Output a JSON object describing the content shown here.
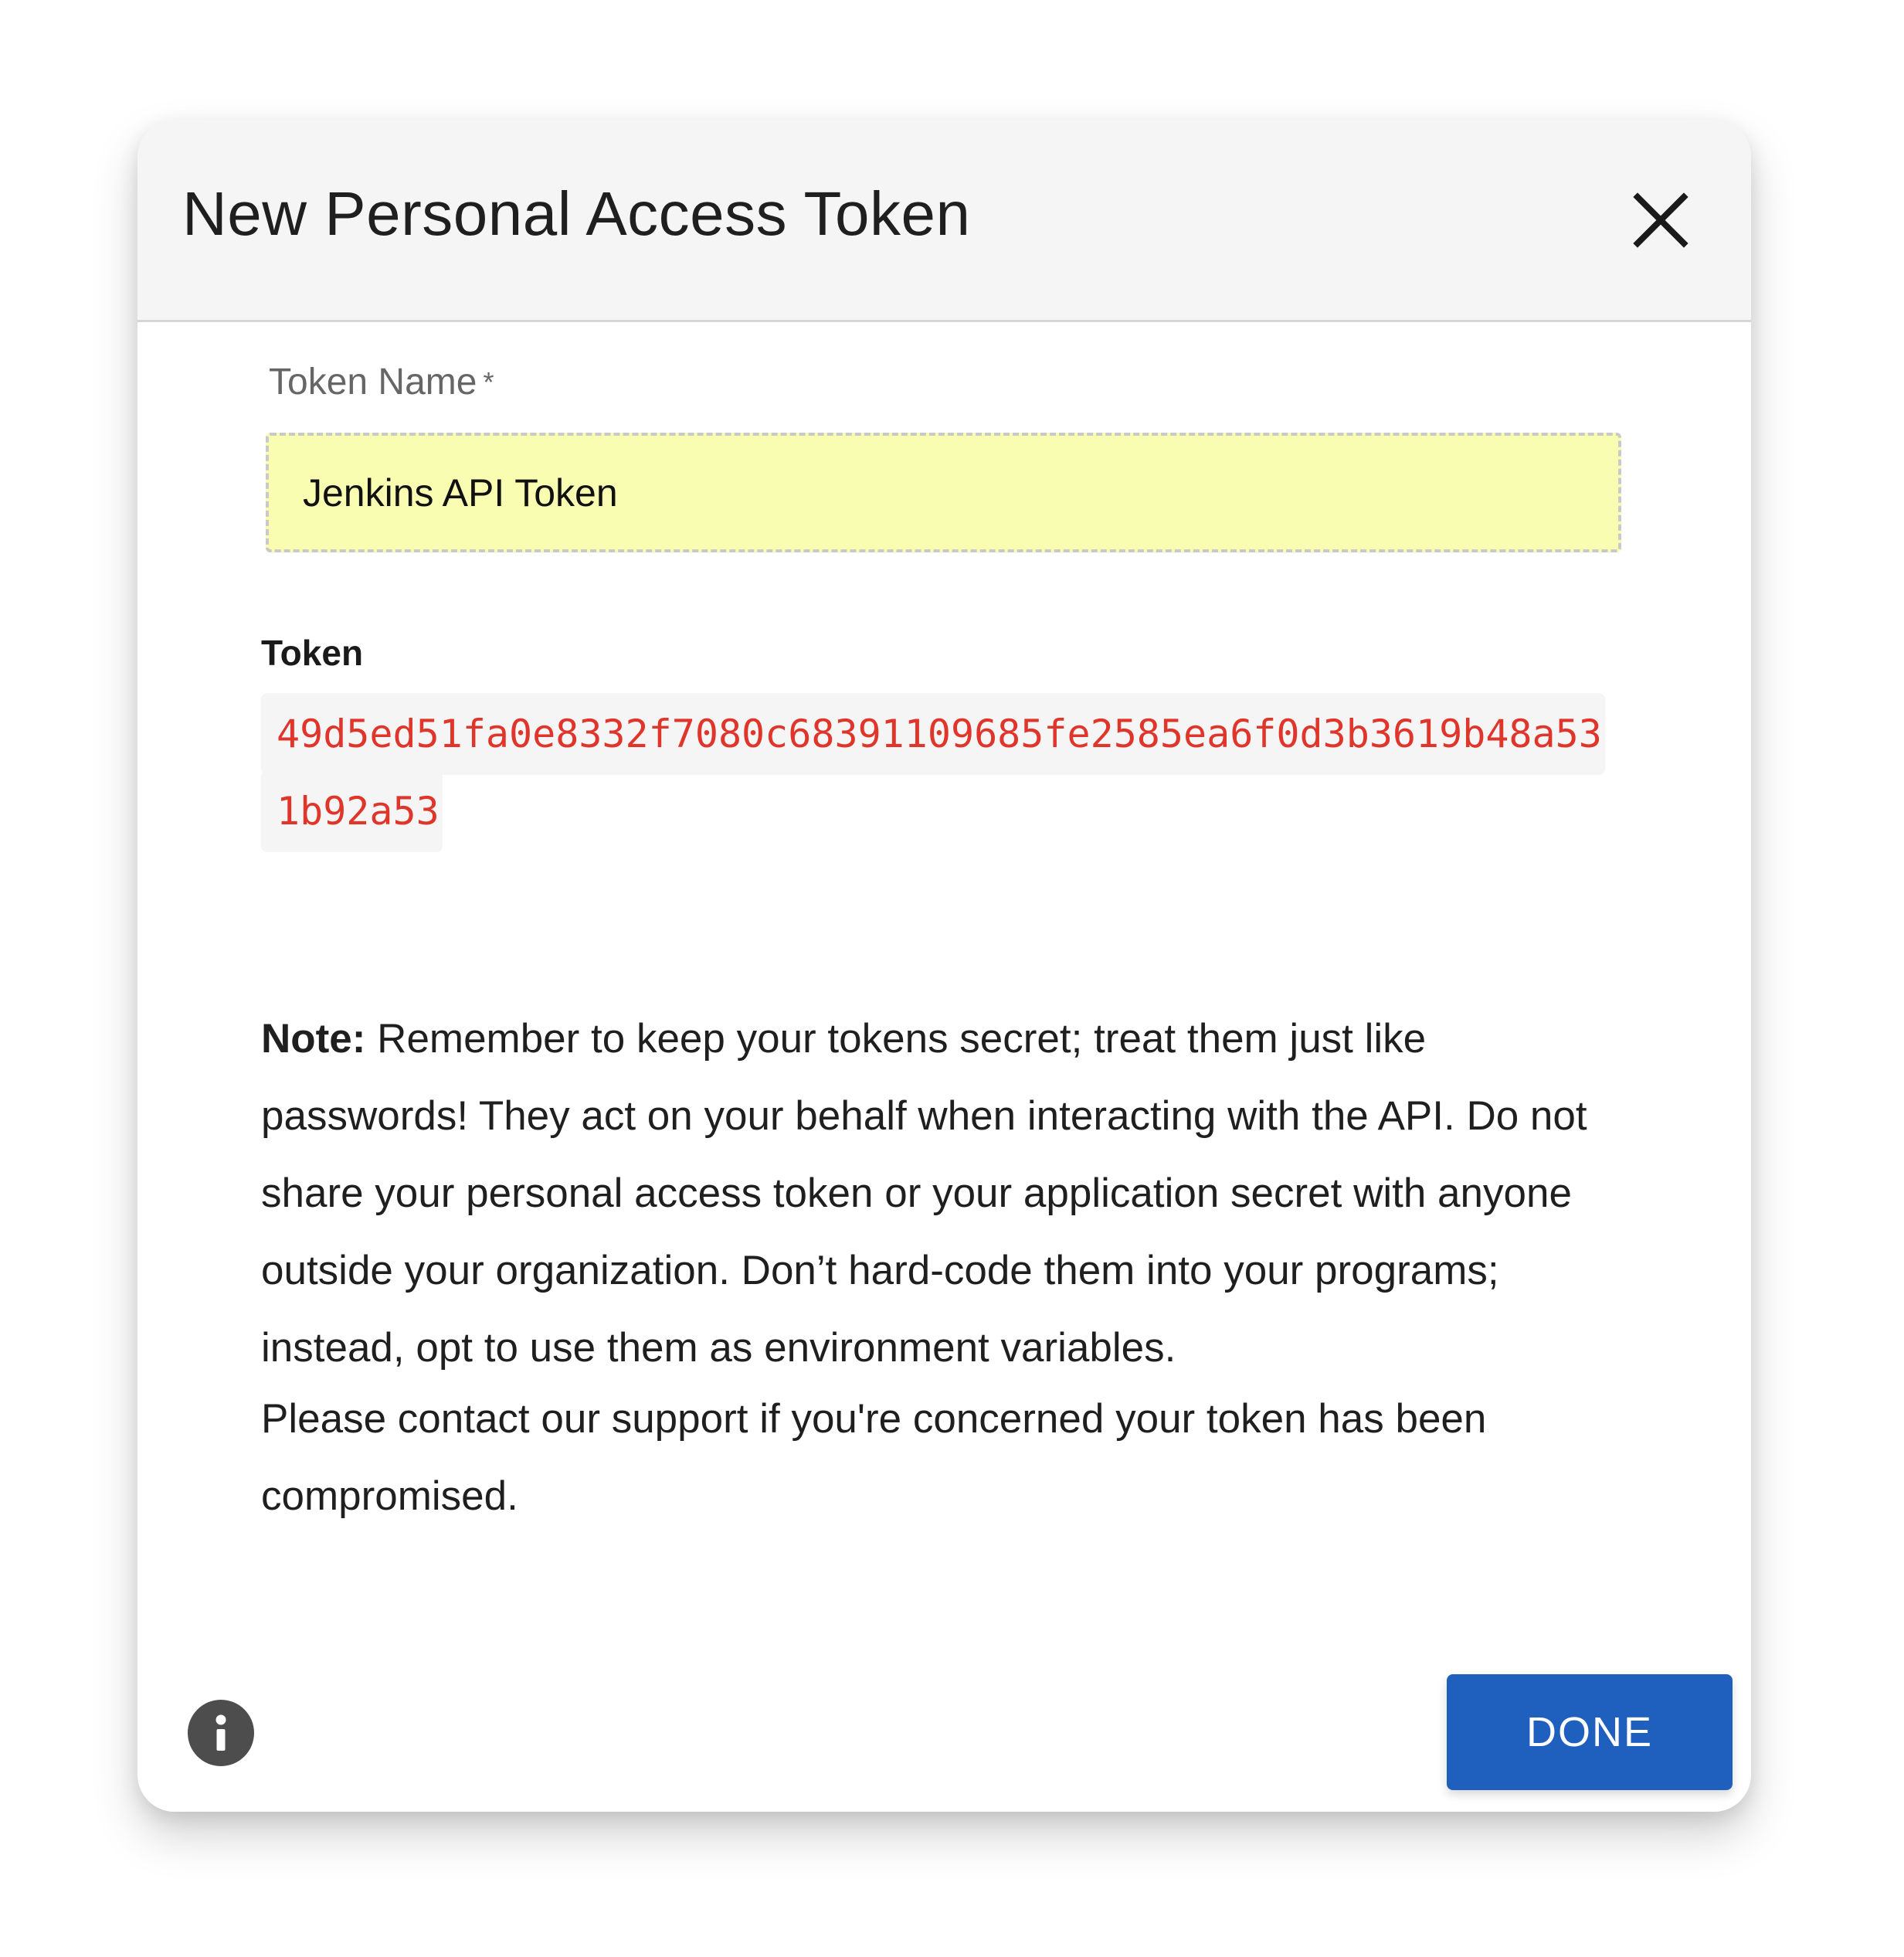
{
  "dialog": {
    "title": "New Personal Access Token",
    "close_icon": "close-icon"
  },
  "token_name": {
    "label": "Token Name",
    "required_marker": "*",
    "value": "Jenkins API Token"
  },
  "token": {
    "label": "Token",
    "value": "49d5ed51fa0e8332f7080c68391109685fe2585ea6f0d3b3619b48a531b92a53"
  },
  "note": {
    "prefix": "Note:",
    "text": "Remember to keep your tokens secret; treat them just like passwords! They act on your behalf when interacting with the API. Do not share your personal access token or your application secret with anyone outside your organization. Don’t hard-code them into your programs; instead, opt to use them as environment variables."
  },
  "support": {
    "text": "Please contact our support if you're concerned your token has been compromised."
  },
  "footer": {
    "info_icon": "info-icon",
    "done_label": "DONE"
  },
  "colors": {
    "header_bg": "#f5f5f5",
    "input_bg": "#f8fdb2",
    "token_text": "#e0352b",
    "primary_button": "#1f60bf",
    "info_icon_bg": "#4d4d4d"
  }
}
